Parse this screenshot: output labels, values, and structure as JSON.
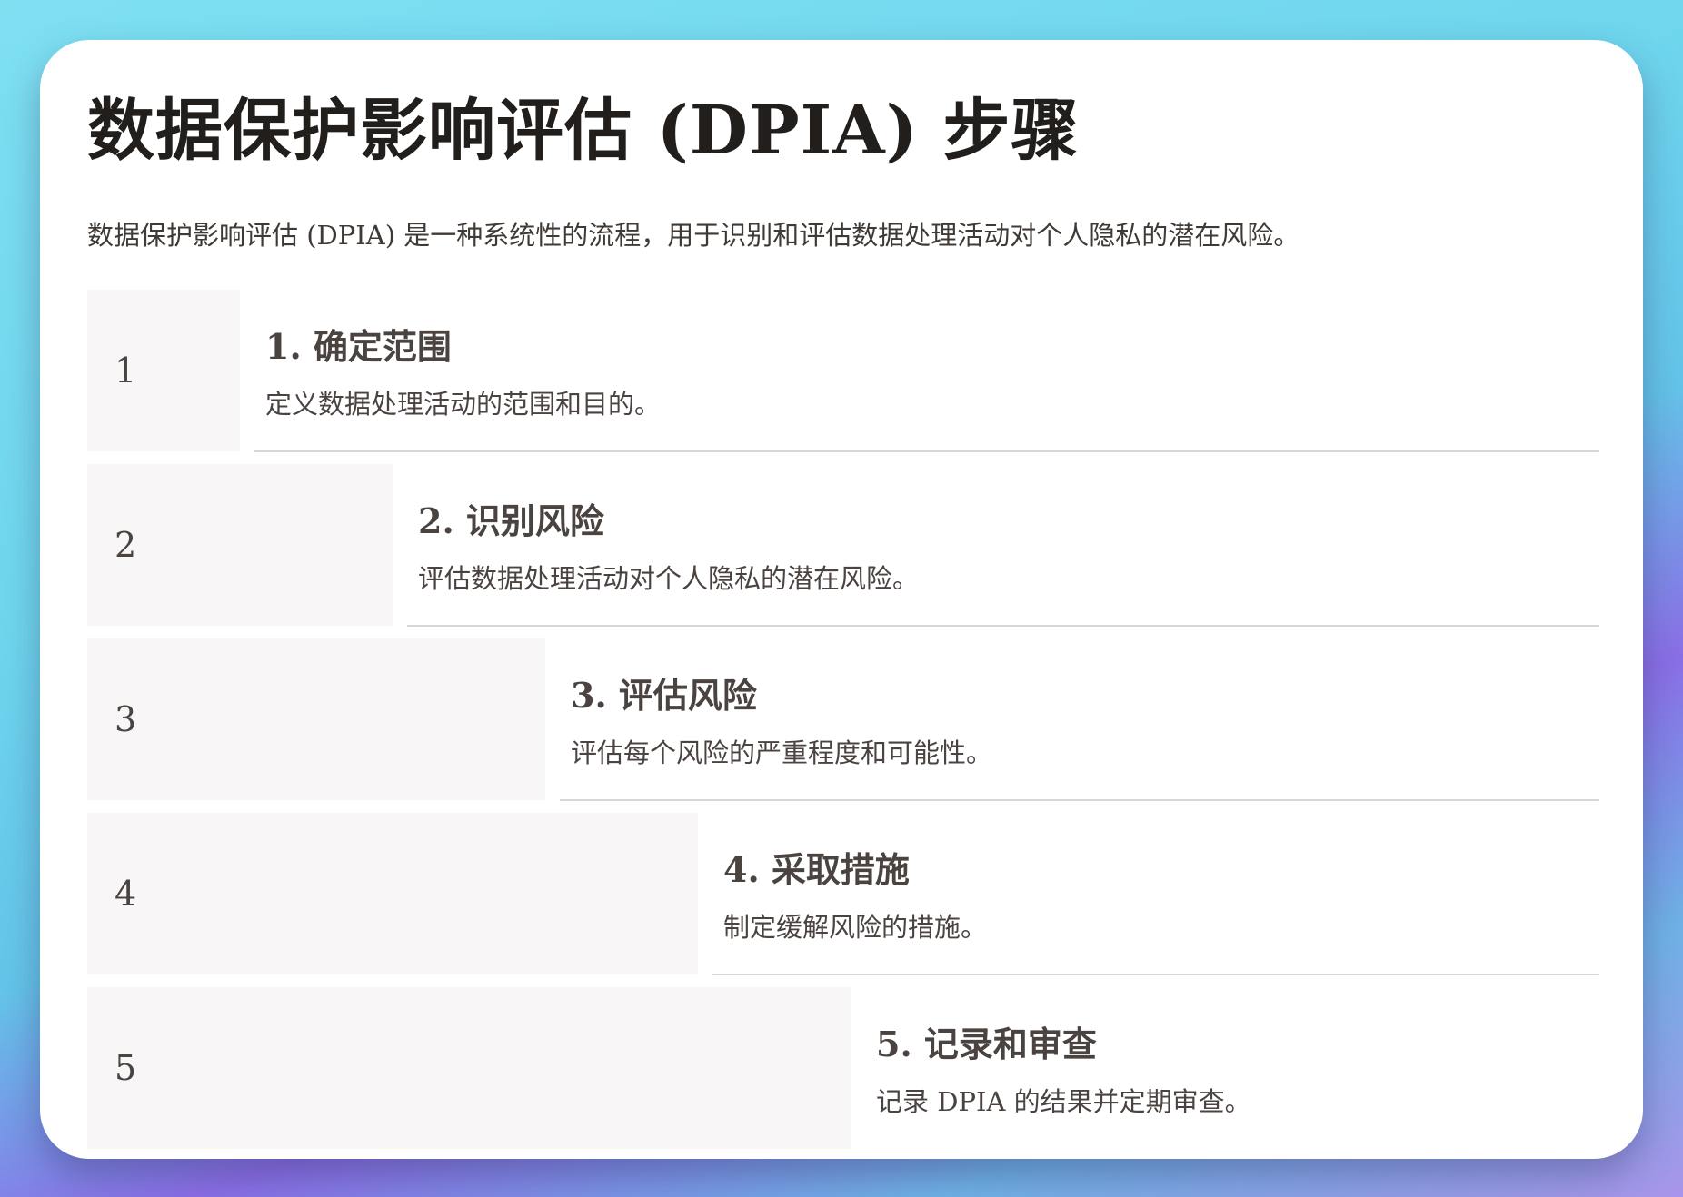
{
  "page": {
    "title": "数据保护影响评估 (DPIA) 步骤",
    "intro": "数据保护影响评估 (DPIA) 是一种系统性的流程，用于识别和评估数据处理活动对个人隐私的潜在风险。"
  },
  "steps": [
    {
      "number": "1",
      "title": "1. 确定范围",
      "description": "定义数据处理活动的范围和目的。"
    },
    {
      "number": "2",
      "title": "2. 识别风险",
      "description": "评估数据处理活动对个人隐私的潜在风险。"
    },
    {
      "number": "3",
      "title": "3. 评估风险",
      "description": "评估每个风险的严重程度和可能性。"
    },
    {
      "number": "4",
      "title": "4. 采取措施",
      "description": "制定缓解风险的措施。"
    },
    {
      "number": "5",
      "title": "5. 记录和审查",
      "description": "记录 DPIA 的结果并定期审查。"
    }
  ],
  "colors": {
    "title_text": "#221e1c",
    "body_text": "#4a4340",
    "step_bar": "#f8f6f6",
    "divider": "#d9d6d5",
    "card": "#ffffff"
  }
}
